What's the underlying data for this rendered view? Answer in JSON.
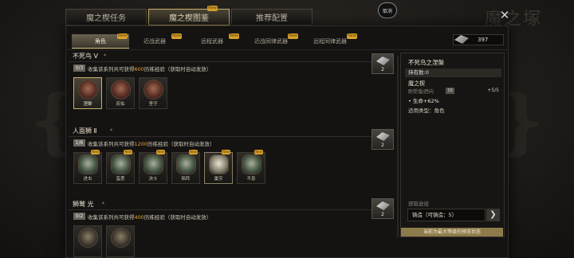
{
  "background_title": "魔之塚",
  "top_tabs": [
    {
      "label": "魔之楔任务",
      "badge": ""
    },
    {
      "label": "魔之楔图鉴",
      "badge": "New"
    },
    {
      "label": "推荐配置",
      "badge": ""
    }
  ],
  "back_label": "取消",
  "close_glyph": "✕",
  "sub_tabs": [
    {
      "label": "角色",
      "badge": "New"
    },
    {
      "label": "近战武器",
      "badge": "New"
    },
    {
      "label": "远程武器",
      "badge": "New"
    },
    {
      "label": "近战同律武器",
      "badge": "New"
    },
    {
      "label": "远程同律武器",
      "badge": "New"
    }
  ],
  "resource_count": "397",
  "sections": [
    {
      "title": "不死鸟 Ⅴ",
      "rank": "0/3",
      "desc_pre": "收集该系列共可获得",
      "desc_num": "600",
      "desc_post": "历练经验（获取时自动发放）",
      "reward_count": "2",
      "items": [
        {
          "name": "涅槃",
          "selected": true,
          "badge": ""
        },
        {
          "name": "庇佑",
          "selected": false,
          "badge": ""
        },
        {
          "name": "坚守",
          "selected": false,
          "badge": ""
        }
      ]
    },
    {
      "title": "人面狮 Ⅱ",
      "rank": "1/6",
      "desc_pre": "收集该系列共可获得",
      "desc_num": "1200",
      "desc_post": "历练经验（获取时自动发放）",
      "reward_count": "2",
      "items": [
        {
          "name": "进击",
          "selected": false,
          "badge": "New"
        },
        {
          "name": "蛮勇",
          "selected": false,
          "badge": "New"
        },
        {
          "name": "决斗",
          "selected": false,
          "badge": "New"
        },
        {
          "name": "陷阵",
          "selected": false,
          "badge": "New"
        },
        {
          "name": "巢穷",
          "selected": false,
          "badge": "New"
        },
        {
          "name": "不息",
          "selected": false,
          "badge": "New"
        }
      ]
    },
    {
      "title": "狮鹫 光",
      "rank": "0/2",
      "desc_pre": "收集该系列共可获得",
      "desc_num": "400",
      "desc_post": "历练经验（获取时自动发放）",
      "reward_count": "2",
      "items": []
    }
  ],
  "detail": {
    "title": "不死鸟之涅槃",
    "own": "持有数:0",
    "name": "魔之楔",
    "dur_label": "耐受值/趋向",
    "level": "10",
    "dur_value": "+5/5",
    "attr": "• 生命+62%",
    "type": "适用类型：角色",
    "source_label": "获取途径",
    "source": "铸造（可铸造：5）",
    "go": "❯",
    "max_label": "当前为最大等级的预览状态"
  }
}
